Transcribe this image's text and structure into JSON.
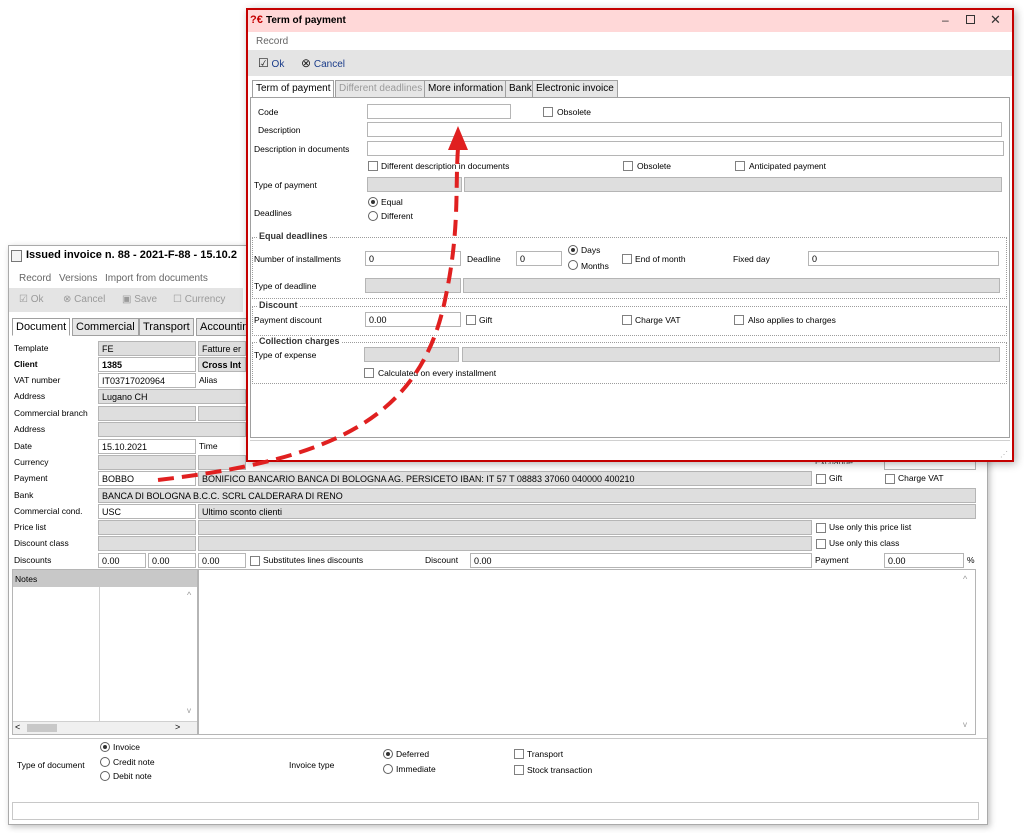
{
  "invoice": {
    "title": "Issued invoice n. 88 - 2021-F-88  -  15.10.2",
    "menu": [
      "Record",
      "Versions",
      "Import from documents"
    ],
    "toolbar": {
      "ok": "Ok",
      "cancel": "Cancel",
      "save": "Save",
      "currency": "Currency"
    },
    "tabs": [
      "Document",
      "Commercial",
      "Transport",
      "Accountin"
    ],
    "fields": {
      "template_label": "Template",
      "template": "FE",
      "template_desc": "Fatture er",
      "client_label": "Client",
      "client": "1385",
      "client_name": "Cross Int",
      "vat_label": "VAT number",
      "vat": "IT03717020964",
      "alias_label": "Alias",
      "address_label": "Address",
      "address": "Lugano  CH",
      "branch_label": "Commercial branch",
      "address2_label": "Address",
      "date_label": "Date",
      "date": "15.10.2021",
      "time_label": "Time",
      "currency_label": "Currency",
      "exchange_label": "Exchange",
      "payment_label": "Payment",
      "payment": "BOBBO",
      "payment_desc": "BONIFICO BANCARIO BANCA DI BOLOGNA AG. PERSICETO IBAN: IT 57 T 08883 37060 040000 400210",
      "gift_label": "Gift",
      "charge_vat_label": "Charge VAT",
      "bank_label": "Bank",
      "bank": "BANCA DI BOLOGNA B.C.C. SCRL CALDERARA DI RENO",
      "commercial_cond_label": "Commercial cond.",
      "commercial_cond": "USC",
      "commercial_cond_desc": "Ultimo sconto clienti",
      "price_list_label": "Price list",
      "use_price_list_label": "Use only this price list",
      "discount_class_label": "Discount class",
      "use_class_label": "Use only this class",
      "discounts_label": "Discounts",
      "disc1": "0.00",
      "disc2": "0.00",
      "disc3": "0.00",
      "substitutes_label": "Substitutes lines discounts",
      "discount_label": "Discount",
      "discount": "0.00",
      "payment_pct_label": "Payment",
      "payment_pct": "0.00",
      "pct_symbol": "%",
      "notes_label": "Notes"
    },
    "bottom": {
      "type_doc_label": "Type of document",
      "type_doc_options": [
        "Invoice",
        "Credit note",
        "Debit note"
      ],
      "invoice_type_label": "Invoice type",
      "invoice_type_options": [
        "Deferred",
        "Immediate"
      ],
      "transport_label": "Transport",
      "stock_label": "Stock transaction"
    }
  },
  "term_of_payment": {
    "title": "Term of payment",
    "title_icon": "?€",
    "menu": "Record",
    "toolbar": {
      "ok": "Ok",
      "cancel": "Cancel"
    },
    "tabs": [
      "Term of payment",
      "Different deadlines",
      "More information",
      "Bank",
      "Electronic invoice"
    ],
    "fields": {
      "code_label": "Code",
      "code": "",
      "obsolete_label": "Obsolete",
      "description_label": "Description",
      "description": "",
      "desc_docs_label": "Description in documents",
      "desc_docs": "",
      "different_desc_label": "Different description in documents",
      "obsolete2_label": "Obsolete",
      "anticipated_label": "Anticipated payment",
      "type_payment_label": "Type of payment",
      "deadlines_label": "Deadlines",
      "deadline_options": [
        "Equal",
        "Different"
      ]
    },
    "equal_deadlines": {
      "title": "Equal deadlines",
      "installments_label": "Number of installments",
      "installments": "0",
      "deadline_label": "Deadline",
      "deadline": "0",
      "unit_options": [
        "Days",
        "Months"
      ],
      "end_month_label": "End of month",
      "fixed_day_label": "Fixed day",
      "fixed_day": "0",
      "type_deadline_label": "Type of deadline"
    },
    "discount": {
      "title": "Discount",
      "payment_discount_label": "Payment discount",
      "payment_discount": "0.00",
      "gift_label": "Gift",
      "charge_vat_label": "Charge VAT",
      "also_applies_label": "Also applies to charges"
    },
    "collection": {
      "title": "Collection charges",
      "type_expense_label": "Type of expense",
      "calc_label": "Calculated on every installment"
    }
  },
  "colors": {
    "accent_border": "#c40000",
    "arrow": "#e02020",
    "titlebar_bg": "#ffd8d8"
  }
}
